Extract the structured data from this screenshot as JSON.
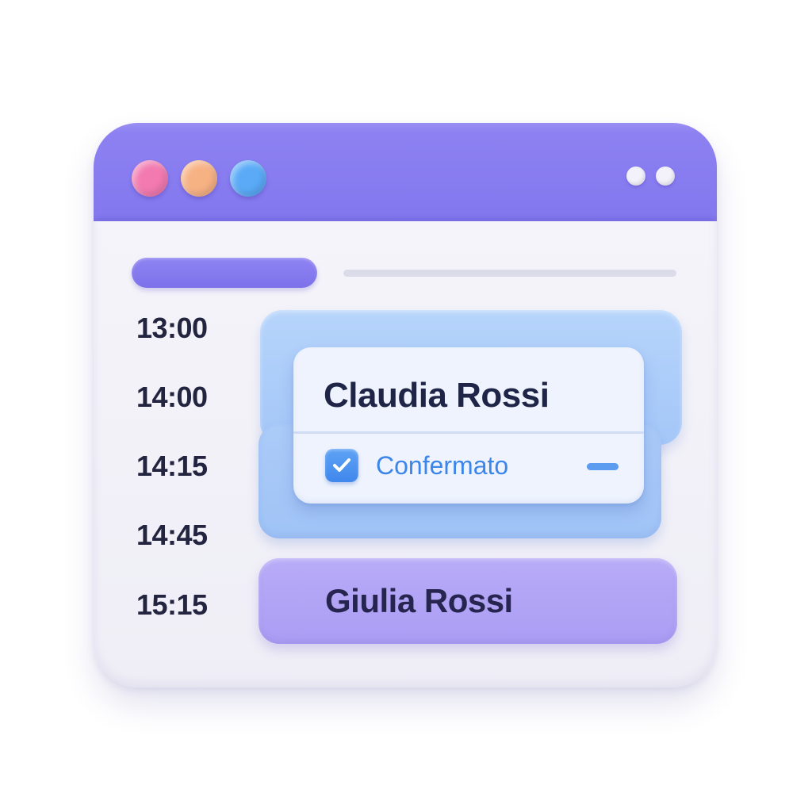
{
  "window": {
    "title_bar_color": "#8b80f0",
    "controls": [
      "close-dot",
      "minimize-dot",
      "maximize-dot"
    ]
  },
  "schedule": {
    "times": [
      "13:00",
      "14:00",
      "14:15",
      "14:45",
      "15:15"
    ],
    "appointments": [
      {
        "name": "Claudia Rossi",
        "status": "Confermato",
        "status_icon": "checkbox-checked-icon",
        "color": "#a8c8f8"
      },
      {
        "name": "Giulia Rossi",
        "color": "#b1a3f5"
      }
    ]
  },
  "colors": {
    "accent_purple": "#8277ee",
    "accent_blue": "#3c86ea",
    "text_dark": "#222440"
  }
}
